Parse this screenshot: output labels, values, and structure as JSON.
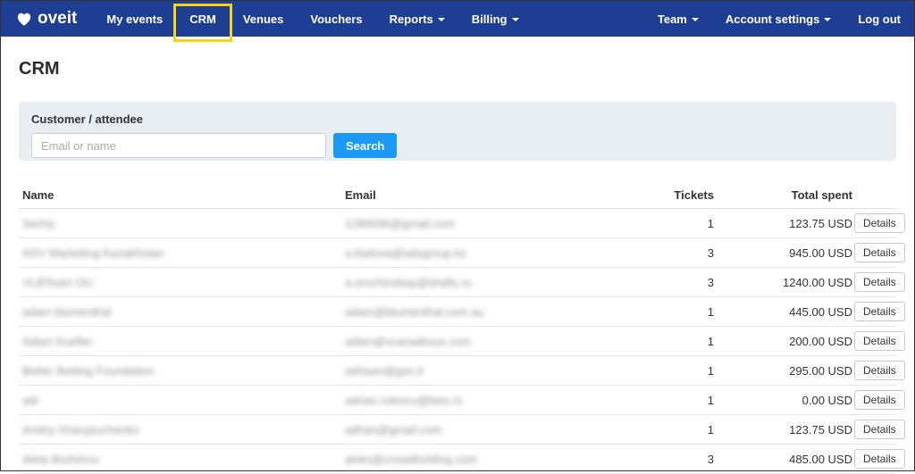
{
  "navbar": {
    "brand": "oveit",
    "items": [
      {
        "label": "My events",
        "dropdown": false
      },
      {
        "label": "CRM",
        "dropdown": false,
        "highlighted": true
      },
      {
        "label": "Venues",
        "dropdown": false
      },
      {
        "label": "Vouchers",
        "dropdown": false
      },
      {
        "label": "Reports",
        "dropdown": true
      },
      {
        "label": "Billing",
        "dropdown": true
      }
    ],
    "right_items": [
      {
        "label": "Team",
        "dropdown": true
      },
      {
        "label": "Account settings",
        "dropdown": true
      },
      {
        "label": "Log out",
        "dropdown": false
      }
    ]
  },
  "page": {
    "title": "CRM"
  },
  "search_panel": {
    "label": "Customer / attendee",
    "input_placeholder": "Email or name",
    "input_value": "",
    "search_button": "Search"
  },
  "table": {
    "headers": {
      "name": "Name",
      "email": "Email",
      "tickets": "Tickets",
      "total": "Total spent"
    },
    "details_label": "Details",
    "rows": [
      {
        "name": "Serhiy",
        "email": "1286696@gmail.com",
        "tickets": "1",
        "total": "123.75 USD"
      },
      {
        "name": "ASV Marketing Kazakhstan",
        "email": "a.bialova@adsgroup.kz",
        "tickets": "3",
        "total": "945.00 USD"
      },
      {
        "name": "VLBTeam OU",
        "email": "a.orochindsay@drafts.ru",
        "tickets": "3",
        "total": "1240.00 USD"
      },
      {
        "name": "adam blumenthal",
        "email": "adam@blumenthal.com.au",
        "tickets": "1",
        "total": "445.00 USD"
      },
      {
        "name": "Adam Kuefler",
        "email": "adam@scaraabous.com",
        "tickets": "1",
        "total": "200.00 USD"
      },
      {
        "name": "Better Betting Foundation",
        "email": "adriaan@gon.li",
        "tickets": "1",
        "total": "295.00 USD"
      },
      {
        "name": "adi",
        "email": "adrian.rolescu@bee.ro",
        "tickets": "1",
        "total": "0.00 USD"
      },
      {
        "name": "Andriy Kharypuchenko",
        "email": "adhan@gmail.com",
        "tickets": "1",
        "total": "123.75 USD"
      },
      {
        "name": "Alela Bozhinov",
        "email": "aleks@crowdholding.com",
        "tickets": "3",
        "total": "485.00 USD"
      }
    ]
  },
  "colors": {
    "navbar_bg": "#1e3e93",
    "highlight_yellow": "#f7d41c",
    "search_button_blue": "#1a9af5",
    "panel_bg": "#e9eef3"
  }
}
